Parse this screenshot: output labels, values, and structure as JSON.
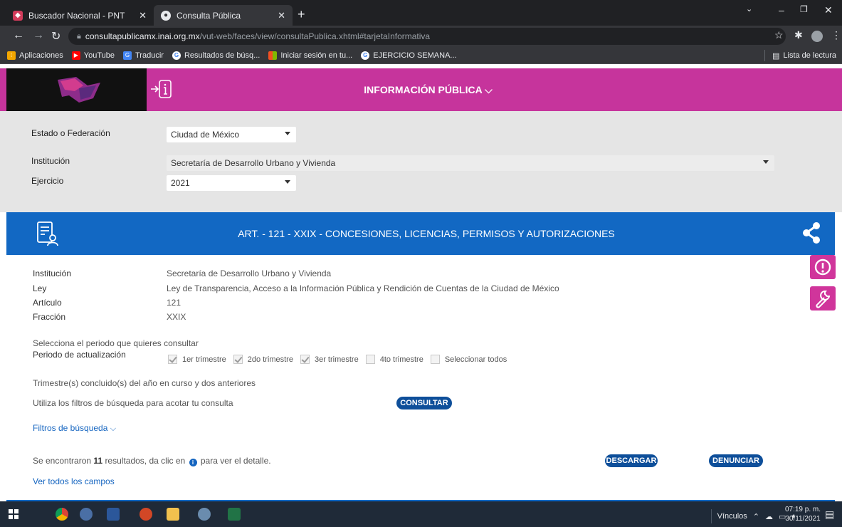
{
  "browser": {
    "tabs": [
      {
        "title": "Buscador Nacional - PNT",
        "active": false
      },
      {
        "title": "Consulta Pública",
        "active": true
      }
    ],
    "new_tab_icon": "plus-icon",
    "url_host": "consultapublicamx.inai.org.mx",
    "url_path": "/vut-web/faces/view/consultaPublica.xhtml#tarjetaInformativa",
    "bookmarks": [
      {
        "label": "Aplicaciones",
        "icon": "apps-grid-icon",
        "color": "#f2a600"
      },
      {
        "label": "YouTube",
        "icon": "youtube-icon",
        "color": "#ff0000"
      },
      {
        "label": "Traducir",
        "icon": "translate-icon",
        "color": "#4285f4"
      },
      {
        "label": "Resultados de búsq...",
        "icon": "google-icon",
        "color": "#4285f4"
      },
      {
        "label": "Iniciar sesión en tu...",
        "icon": "microsoft-icon",
        "color": "#f25022"
      },
      {
        "label": "EJERCICIO SEMANA...",
        "icon": "google-icon",
        "color": "#4285f4"
      }
    ],
    "reading_list": "Lista de lectura"
  },
  "header": {
    "title": "INFORMACIÓN PÚBLICA ⌵",
    "bg_color": "#c6349c"
  },
  "filters": {
    "estado_label": "Estado o Federación",
    "estado_value": "Ciudad de México",
    "institucion_label": "Institución",
    "institucion_value": "Secretaría de Desarrollo Urbano y Vivienda",
    "ejercicio_label": "Ejercicio",
    "ejercicio_value": "2021"
  },
  "article": {
    "title": "ART. - 121 - XXIX - CONCESIONES, LICENCIAS, PERMISOS Y AUTORIZACIONES",
    "bg_color": "#1268c3"
  },
  "details": [
    {
      "key": "Institución",
      "value": "Secretaría de Desarrollo Urbano y Vivienda"
    },
    {
      "key": "Ley",
      "value": "Ley de Transparencia, Acceso a la Información Pública y Rendición de Cuentas de la Ciudad de México"
    },
    {
      "key": "Artículo",
      "value": "121"
    },
    {
      "key": "Fracción",
      "value": "XXIX"
    }
  ],
  "periodo": {
    "prompt": "Selecciona el periodo que quieres consultar",
    "label": "Periodo de actualización",
    "options": [
      {
        "label": "1er trimestre",
        "checked": true
      },
      {
        "label": "2do trimestre",
        "checked": true
      },
      {
        "label": "3er trimestre",
        "checked": true
      },
      {
        "label": "4to trimestre",
        "checked": false
      },
      {
        "label": "Seleccionar todos",
        "checked": false
      }
    ],
    "note": "Trimestre(s) concluido(s) del año en curso y dos anteriores"
  },
  "search": {
    "hint": "Utiliza los filtros de búsqueda para acotar tu consulta",
    "consultar_label": "CONSULTAR",
    "filters_link": "Filtros de búsqueda"
  },
  "results": {
    "prefix": "Se encontraron",
    "count": "11",
    "middle": "resultados, da clic en",
    "suffix": "para ver el detalle.",
    "descargar_label": "DESCARGAR",
    "denunciar_label": "DENUNCIAR",
    "all_fields_link": "Ver todos los campos"
  },
  "taskbar": {
    "tray_label": "Vínculos",
    "time": "07:19 p. m.",
    "date": "30/11/2021",
    "apps": [
      "windows-start-icon",
      "chrome-icon",
      "edge-icon",
      "word-icon",
      "powerpoint-icon",
      "file-explorer-icon",
      "chrome-alt-icon",
      "excel-icon"
    ]
  }
}
